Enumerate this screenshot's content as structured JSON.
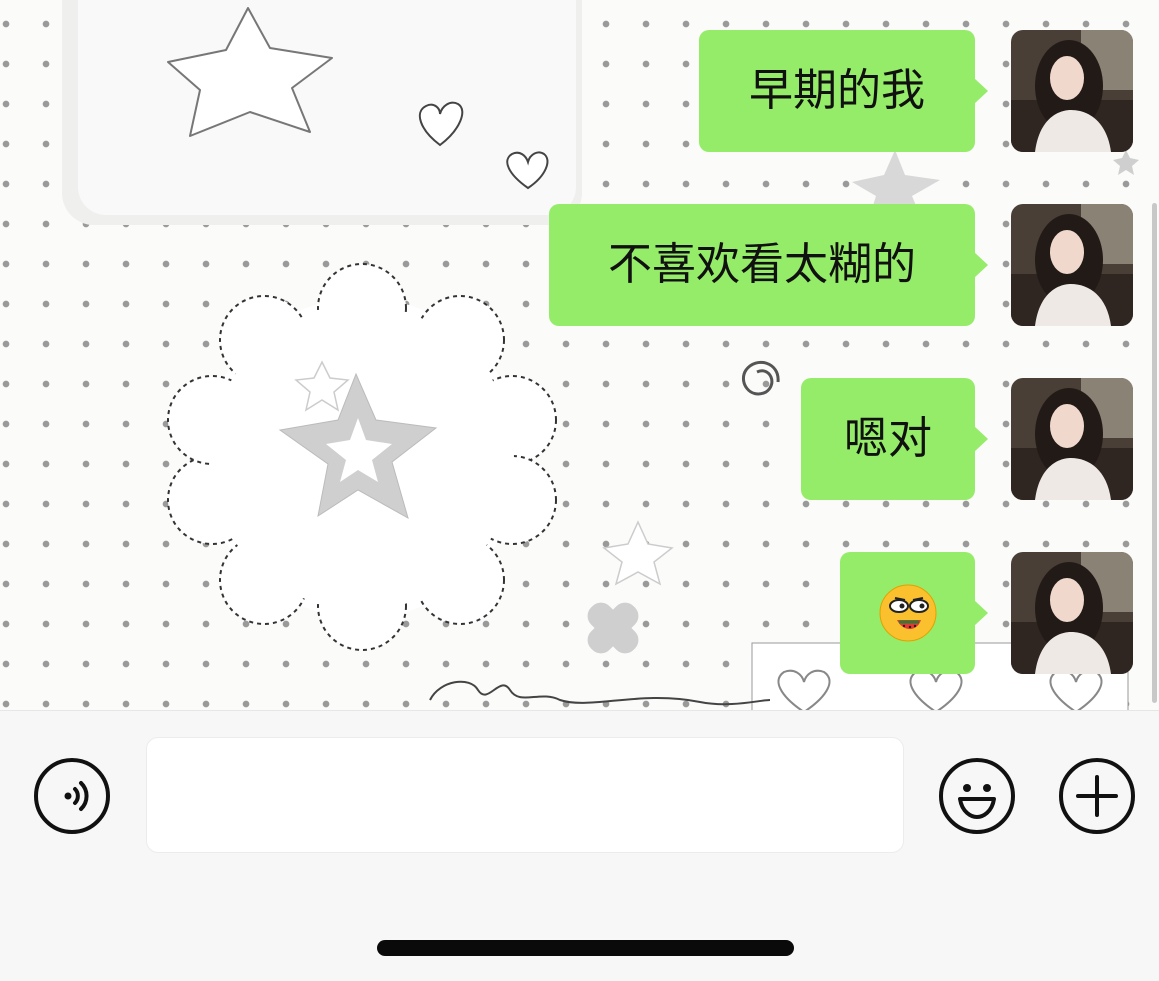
{
  "chat": {
    "messages": [
      {
        "text": "早期的我",
        "sender": "self"
      },
      {
        "text": "不喜欢看太糊的",
        "sender": "self"
      },
      {
        "text": "嗯对",
        "sender": "self"
      },
      {
        "text": "🥵",
        "sender": "self",
        "kind": "emoji"
      }
    ],
    "bubble_color": "#95ec69",
    "background_icons": [
      "star-icon",
      "heart-icon",
      "flower-icon",
      "swirl-icon",
      "cross-icon"
    ]
  },
  "input_bar": {
    "voice_icon": "voice-icon",
    "emoji_icon": "emoji-icon",
    "add_icon": "plus-icon",
    "message_value": ""
  }
}
